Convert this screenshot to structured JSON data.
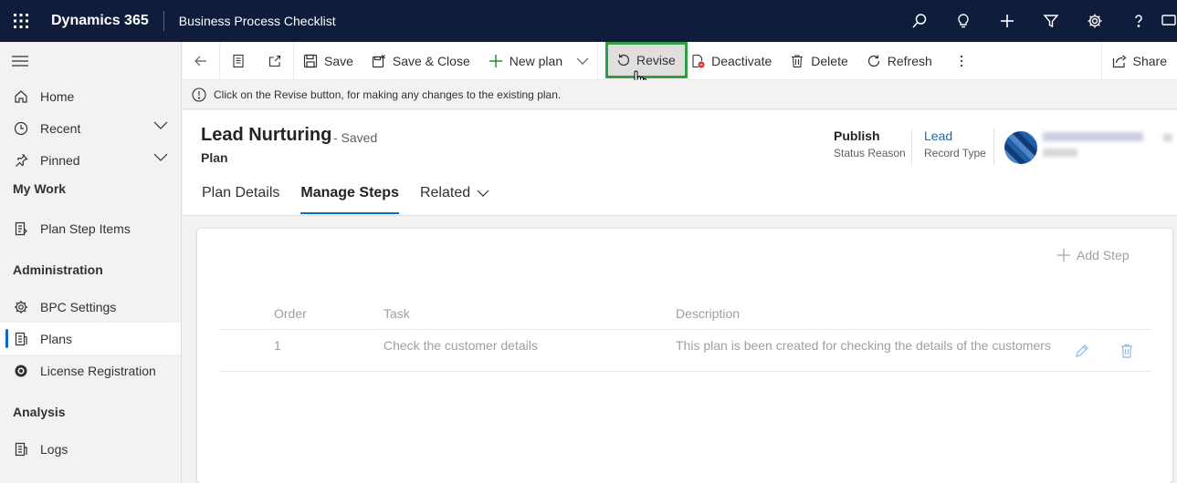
{
  "topbar": {
    "brand": "Dynamics 365",
    "app_name": "Business Process Checklist",
    "bg_color": "#0f1c3c"
  },
  "sidebar": {
    "items": [
      {
        "label": "Home",
        "icon": "home-icon"
      },
      {
        "label": "Recent",
        "icon": "clock-icon"
      },
      {
        "label": "Pinned",
        "icon": "pin-icon"
      }
    ],
    "sections": [
      {
        "title": "My Work",
        "items": [
          {
            "label": "Plan Step Items",
            "icon": "document-icon"
          }
        ]
      },
      {
        "title": "Administration",
        "items": [
          {
            "label": "BPC Settings",
            "icon": "gear-icon"
          },
          {
            "label": "Plans",
            "icon": "plans-icon",
            "active": true
          },
          {
            "label": "License Registration",
            "icon": "badge-icon"
          }
        ]
      },
      {
        "title": "Analysis",
        "items": [
          {
            "label": "Logs",
            "icon": "logs-icon"
          }
        ]
      }
    ]
  },
  "commandbar": {
    "save": "Save",
    "save_close": "Save & Close",
    "new_plan": "New plan",
    "revise": "Revise",
    "deactivate": "Deactivate",
    "delete": "Delete",
    "refresh": "Refresh",
    "share": "Share"
  },
  "notice": {
    "text": "Click on the Revise button, for making any changes to the existing plan."
  },
  "record": {
    "title": "Lead Nurturing",
    "saved_status": "- Saved",
    "entity": "Plan",
    "status_reason_value": "Publish",
    "status_reason_label": "Status Reason",
    "record_type_value": "Lead",
    "record_type_label": "Record Type"
  },
  "tabs": [
    {
      "label": "Plan Details",
      "active": false
    },
    {
      "label": "Manage Steps",
      "active": true
    },
    {
      "label": "Related",
      "active": false
    }
  ],
  "steps": {
    "add_label": "Add Step",
    "columns": {
      "order": "Order",
      "task": "Task",
      "description": "Description"
    },
    "rows": [
      {
        "order": "1",
        "task": "Check the customer details",
        "description": "This plan is been created for checking the details of the customers"
      }
    ]
  },
  "colors": {
    "accent": "#0f6cbd",
    "highlight_border": "#2ea043"
  }
}
